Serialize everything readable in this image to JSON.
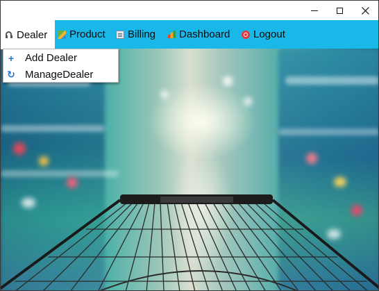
{
  "window": {
    "controls": {
      "minimize": "minimize-icon",
      "maximize": "maximize-icon",
      "close": "close-icon"
    }
  },
  "menubar": {
    "background": "#1ab8e8",
    "items": [
      {
        "label": "Dealer",
        "icon": "headset-icon",
        "active": true
      },
      {
        "label": "Product",
        "icon": "product-icon"
      },
      {
        "label": "Billing",
        "icon": "billing-icon"
      },
      {
        "label": "Dashboard",
        "icon": "chart-icon"
      },
      {
        "label": "Logout",
        "icon": "logout-icon"
      }
    ]
  },
  "dealer_menu": {
    "items": [
      {
        "label": "Add Dealer",
        "icon": "plus-icon",
        "glyph": "+"
      },
      {
        "label": "ManageDealer",
        "icon": "refresh-icon",
        "glyph": "↻"
      }
    ]
  },
  "background": {
    "image": "supermarket-aisle-with-shopping-cart"
  }
}
